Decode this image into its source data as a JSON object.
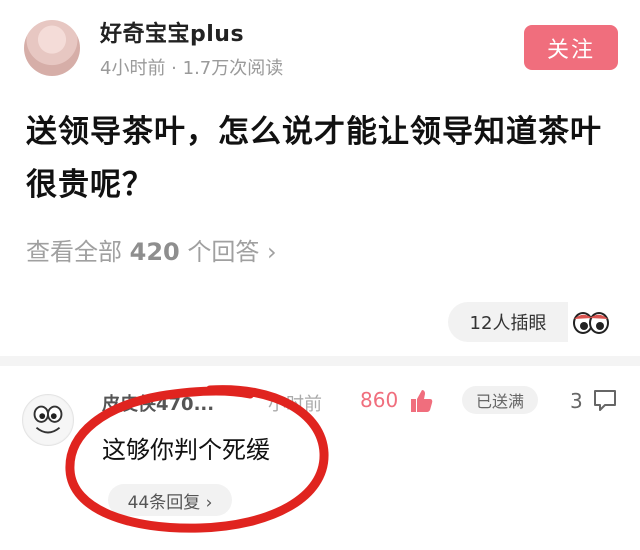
{
  "author": {
    "name": "好奇宝宝plus",
    "meta": "4小时前 · 1.7万次阅读",
    "follow_label": "关注"
  },
  "question": {
    "text": "送领导茶叶，怎么说才能让领导知道茶叶很贵呢？",
    "view_all_prefix": "查看全部",
    "answers_count": "420",
    "view_all_suffix": "个回答 ›"
  },
  "eye": {
    "label": "12人插眼",
    "icon": "eyes-icon"
  },
  "comment": {
    "user": "皮皮侠470...",
    "time": "小时前",
    "likes": "860",
    "reward": "已送满",
    "comments": "3",
    "text": "这够你判个死缓",
    "replies": "44条回复 ›",
    "highlight_color": "#e0241f"
  },
  "colors": {
    "accent": "#f06e7d"
  }
}
